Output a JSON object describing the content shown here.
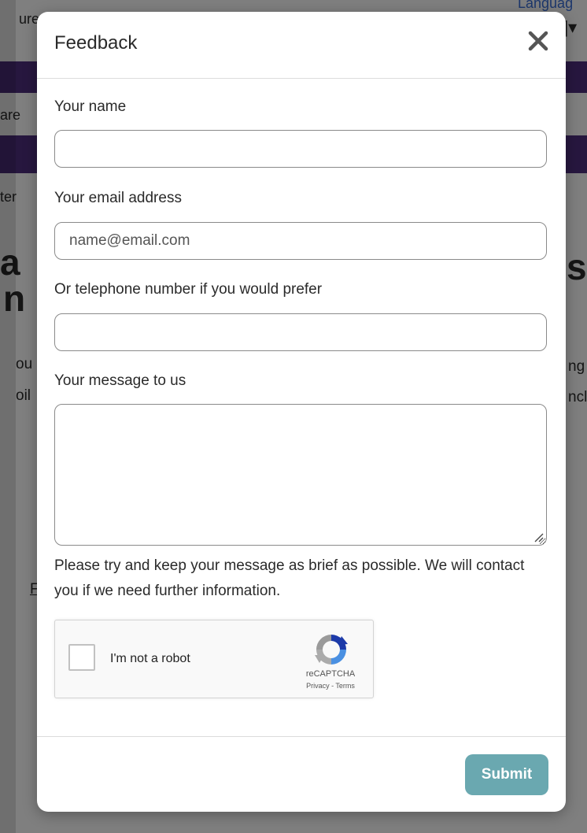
{
  "background": {
    "top_left_text": "ure",
    "top_right_text": "Languag",
    "top_right_control": "]▾",
    "left_row1": "are",
    "left_row2": "ter",
    "heading_left1": "a",
    "heading_left2": "n",
    "heading_right": "s",
    "body_left1": "ou",
    "body_left2": "oil",
    "body_right1": "ng",
    "body_right2": "ncl",
    "link_frag": "F"
  },
  "modal": {
    "title": "Feedback",
    "close_label": "×"
  },
  "form": {
    "name_label": "Your name",
    "name_value": "",
    "email_label": "Your email address",
    "email_placeholder": "name@email.com",
    "phone_label": "Or telephone number if you would prefer",
    "phone_value": "",
    "message_label": "Your message to us",
    "message_value": "",
    "hint": "Please try and keep your message as brief as possible. We will contact you if we need further information."
  },
  "recaptcha": {
    "label": "I'm not a robot",
    "brand": "reCAPTCHA",
    "links": "Privacy - Terms"
  },
  "footer": {
    "submit_label": "Submit"
  },
  "colors": {
    "submit_bg": "#6aa8b0",
    "page_band": "#4f2f7f",
    "overlay": "rgba(0,0,0,0.5)"
  }
}
